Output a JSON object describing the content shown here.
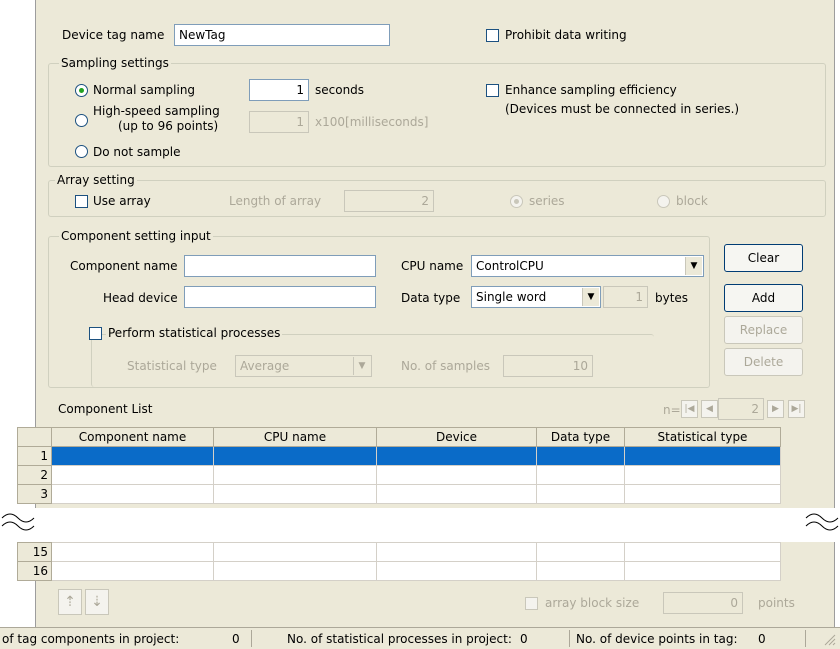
{
  "device_tag": {
    "label": "Device tag name",
    "value": "NewTag",
    "prohibit_label": "Prohibit data writing"
  },
  "sampling": {
    "legend": "Sampling settings",
    "normal_label": "Normal sampling",
    "normal_value": "1",
    "normal_unit": "seconds",
    "highspeed_label": "High-speed sampling",
    "highspeed_label2": "(up to 96 points)",
    "highspeed_value": "1",
    "highspeed_unit": "x100[milliseconds]",
    "donot_label": "Do not sample",
    "enhance_label": "Enhance sampling efficiency",
    "enhance_note": "(Devices must be connected in series.)"
  },
  "array": {
    "legend": "Array setting",
    "use_label": "Use array",
    "length_label": "Length of array",
    "length_value": "2",
    "series_label": "series",
    "block_label": "block"
  },
  "component": {
    "legend": "Component setting input",
    "name_label": "Component name",
    "name_value": "",
    "head_label": "Head device",
    "head_value": "",
    "cpu_label": "CPU name",
    "cpu_value": "ControlCPU",
    "datatype_label": "Data type",
    "datatype_value": "Single word",
    "bytes_value": "1",
    "bytes_label": "bytes",
    "stat_check_label": "Perform statistical processes",
    "stat_type_label": "Statistical type",
    "stat_type_value": "Average",
    "samples_label": "No. of samples",
    "samples_value": "10",
    "clear_label": "Clear",
    "add_label": "Add",
    "replace_label": "Replace",
    "delete_label": "Delete"
  },
  "list": {
    "title": "Component List",
    "n_label": "n=",
    "n_value": "2",
    "headers": [
      "Component name",
      "CPU name",
      "Device",
      "Data type",
      "Statistical type"
    ],
    "rows_top": [
      "1",
      "2",
      "3"
    ],
    "rows_bottom": [
      "15",
      "16"
    ],
    "array_block_label": "array block size",
    "array_block_value": "0",
    "points_label": "points"
  },
  "status_bar": {
    "tag_components": "of tag components in project:",
    "tag_components_value": "0",
    "stat_processes": "No. of statistical processes in project:",
    "stat_processes_value": "0",
    "device_points": "No. of device points in tag:",
    "device_points_value": "0"
  },
  "colors": {
    "panel": "#ece9d8",
    "selection": "#0a6bc8"
  }
}
